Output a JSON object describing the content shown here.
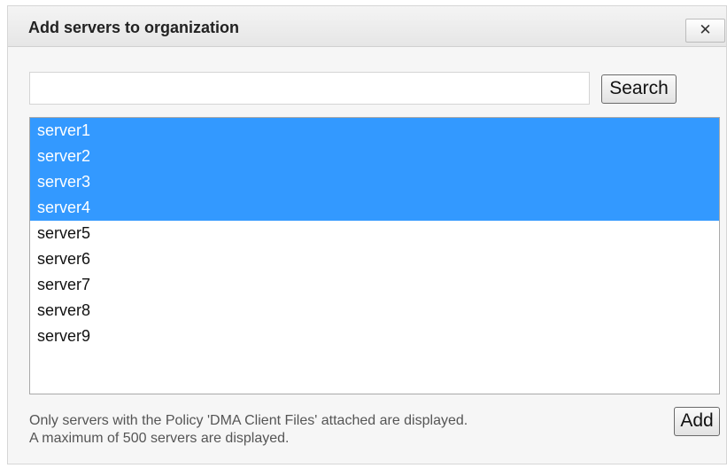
{
  "dialog": {
    "title": "Add servers to organization",
    "close_label": "✕"
  },
  "search": {
    "value": "",
    "placeholder": "",
    "button_label": "Search"
  },
  "servers": [
    {
      "name": "server1",
      "selected": true
    },
    {
      "name": "server2",
      "selected": true
    },
    {
      "name": "server3",
      "selected": true
    },
    {
      "name": "server4",
      "selected": true
    },
    {
      "name": "server5",
      "selected": false
    },
    {
      "name": "server6",
      "selected": false
    },
    {
      "name": "server7",
      "selected": false
    },
    {
      "name": "server8",
      "selected": false
    },
    {
      "name": "server9",
      "selected": false
    }
  ],
  "info": {
    "line1": "Only servers with the Policy 'DMA Client Files' attached are displayed.",
    "line2": "A maximum of 500 servers are displayed."
  },
  "add_button_label": "Add",
  "colors": {
    "selection": "#3399ff",
    "selection_text": "#ffffff"
  }
}
